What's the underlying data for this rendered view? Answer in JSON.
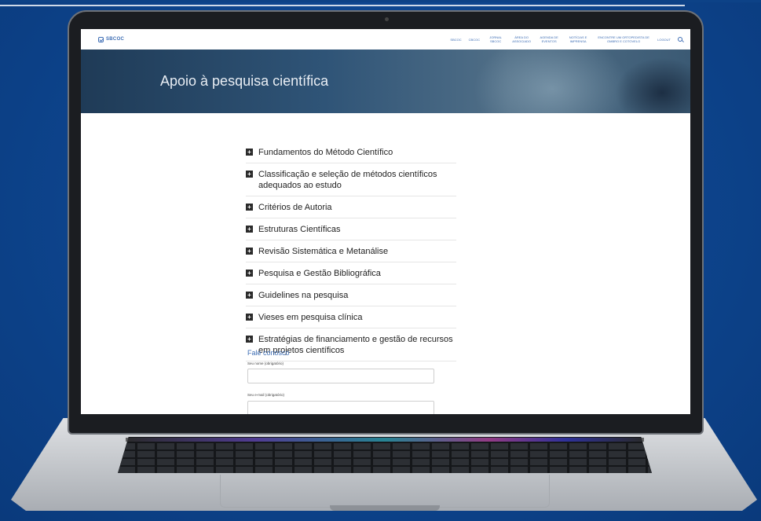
{
  "site": {
    "logo_text": "SBCOC",
    "nav": [
      "SBCOC",
      "CBCOC",
      "JORNAL SBCOC",
      "ÁREA DO ASSOCIADO",
      "AGENDA DE EVENTOS",
      "NOTÍCIAS E IMPRENSA",
      "ENCONTRE UM ORTOPEDISTA DE OMBRO E COTOVELO",
      "LOGOUT"
    ]
  },
  "hero": {
    "title": "Apoio à pesquisa científica"
  },
  "accordion": [
    "Fundamentos do Método Científico",
    "Classificação e seleção de métodos científicos adequados ao estudo",
    "Critérios de Autoria",
    "Estruturas Científicas",
    "Revisão Sistemática e Metanálise",
    "Pesquisa e Gestão Bibliográfica",
    "Guidelines na pesquisa",
    "Vieses em pesquisa clínica",
    "Estratégias de financiamento e gestão de recursos em projetos científicos"
  ],
  "accordion_icon": "+",
  "contact": {
    "title": "Fale conosco",
    "name_label": "Seu nome (obrigatório)",
    "email_label": "Seu e-mail (obrigatório)"
  }
}
